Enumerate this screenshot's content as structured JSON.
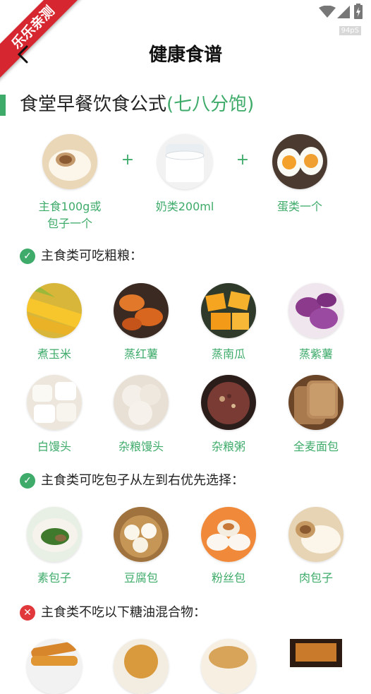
{
  "status_bar": {
    "fps": "94pS"
  },
  "ribbon": "乐乐亲测",
  "header": {
    "title": "健康食谱"
  },
  "section": {
    "title_main": "食堂早餐饮食公式",
    "title_highlight": "(七八分饱)"
  },
  "formula": {
    "items": [
      {
        "label_line1": "主食100g或",
        "label_line2": "包子一个",
        "icon": "steamed-bun-image"
      },
      {
        "label_line1": "奶类200ml",
        "label_line2": "",
        "icon": "milk-glass-image"
      },
      {
        "label_line1": "蛋类一个",
        "label_line2": "",
        "icon": "boiled-egg-image"
      }
    ],
    "plus": "+"
  },
  "group_coarse": {
    "heading": "主食类可吃粗粮：",
    "items": [
      {
        "label": "煮玉米",
        "icon": "corn-image"
      },
      {
        "label": "蒸红薯",
        "icon": "sweet-potato-image"
      },
      {
        "label": "蒸南瓜",
        "icon": "pumpkin-image"
      },
      {
        "label": "蒸紫薯",
        "icon": "purple-potato-image"
      },
      {
        "label": "白馒头",
        "icon": "white-bun-image"
      },
      {
        "label": "杂粮馒头",
        "icon": "multigrain-bun-image"
      },
      {
        "label": "杂粮粥",
        "icon": "grain-porridge-image"
      },
      {
        "label": "全麦面包",
        "icon": "wholewheat-bread-image"
      }
    ]
  },
  "group_buns": {
    "heading": "主食类可吃包子从左到右优先选择：",
    "items": [
      {
        "label": "素包子",
        "icon": "veg-bun-image"
      },
      {
        "label": "豆腐包",
        "icon": "tofu-bun-image"
      },
      {
        "label": "粉丝包",
        "icon": "vermicelli-bun-image"
      },
      {
        "label": "肉包子",
        "icon": "meat-bun-image"
      }
    ]
  },
  "group_avoid": {
    "heading": "主食类不吃以下糖油混合物："
  },
  "colors": {
    "accent": "#3eab6a",
    "ribbon": "#d6262f",
    "avoid": "#e0383b"
  }
}
